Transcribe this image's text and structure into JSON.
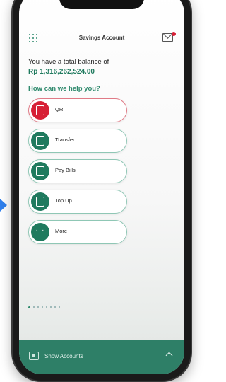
{
  "header": {
    "title": "Savings Account"
  },
  "balance": {
    "label": "You have a total balance of",
    "amount": "Rp 1,316,262,524.00"
  },
  "help": {
    "prompt": "How can we help you?"
  },
  "menu": {
    "items": [
      {
        "label": "QR"
      },
      {
        "label": "Transfer"
      },
      {
        "label": "Pay Bills"
      },
      {
        "label": "Top Up"
      },
      {
        "label": "More"
      }
    ]
  },
  "footer": {
    "label": "Show Accounts"
  },
  "colors": {
    "brand": "#2e7f67",
    "accent": "#d71f35"
  }
}
